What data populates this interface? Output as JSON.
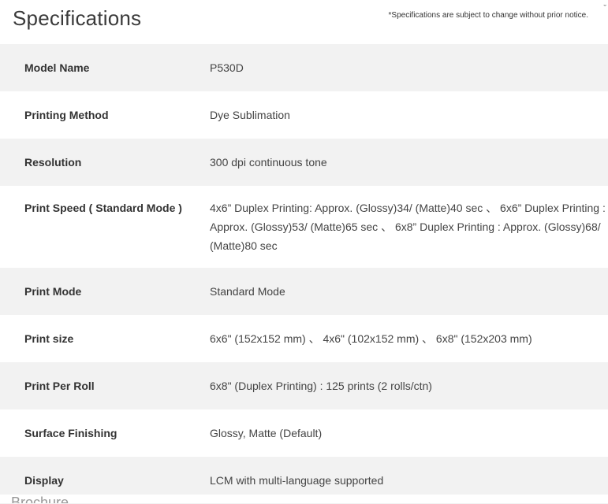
{
  "header": {
    "title": "Specifications",
    "notice": "*Specifications are subject to change without prior notice.",
    "corner_mark": "ˇ"
  },
  "specs": [
    {
      "label": "Model Name",
      "value": "P530D"
    },
    {
      "label": "Printing Method",
      "value": "Dye Sublimation"
    },
    {
      "label": "Resolution",
      "value": "300 dpi continuous tone"
    },
    {
      "label": "Print Speed ( Standard Mode )",
      "value": "4x6” Duplex Printing: Approx. (Glossy)34/ (Matte)40 sec 、 6x6” Duplex Printing : Approx. (Glossy)53/ (Matte)65 sec 、 6x8” Duplex Printing : Approx. (Glossy)68/ (Matte)80 sec"
    },
    {
      "label": "Print Mode",
      "value": "Standard Mode"
    },
    {
      "label": "Print size",
      "value": "6x6\" (152x152 mm) 、 4x6\" (102x152 mm) 、 6x8\" (152x203 mm)"
    },
    {
      "label": "Print Per Roll",
      "value": "6x8\" (Duplex Printing) : 125 prints (2 rolls/ctn)"
    },
    {
      "label": "Surface Finishing",
      "value": "Glossy, Matte (Default)"
    },
    {
      "label": "Display",
      "value": "LCM with multi-language supported"
    }
  ],
  "footer": {
    "partial_text": "Brochure"
  }
}
